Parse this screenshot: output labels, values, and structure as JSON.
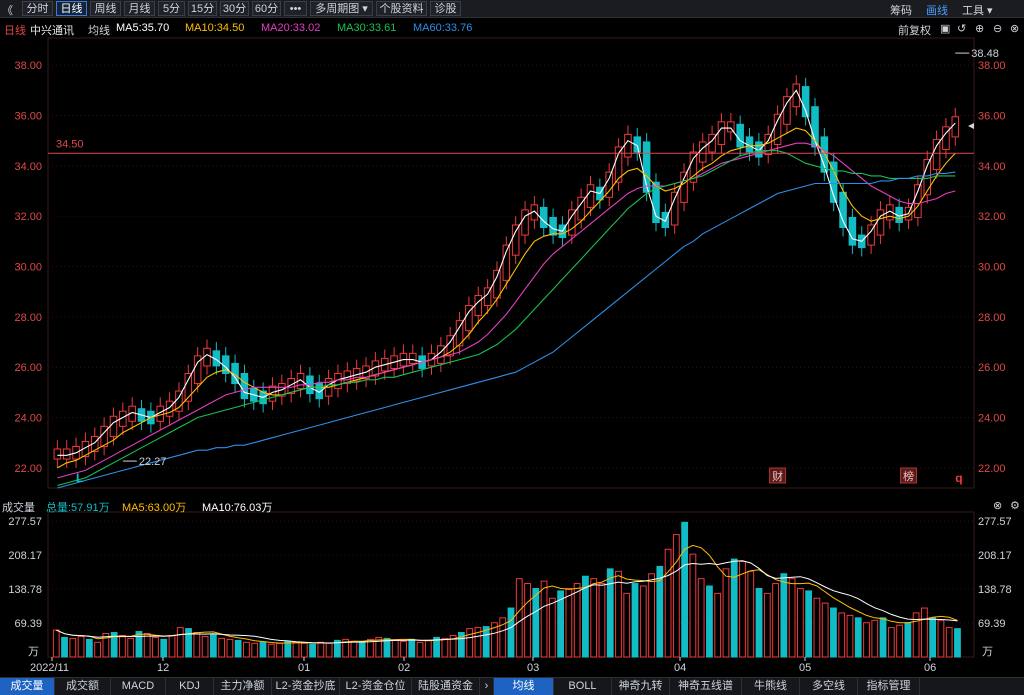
{
  "toolbar": {
    "back": "《",
    "tabs": [
      {
        "label": "分时",
        "active": false
      },
      {
        "label": "日线",
        "active": true
      },
      {
        "label": "周线",
        "active": false
      },
      {
        "label": "月线",
        "active": false
      },
      {
        "label": "5分",
        "active": false
      },
      {
        "label": "15分",
        "active": false
      },
      {
        "label": "30分",
        "active": false
      },
      {
        "label": "60分",
        "active": false
      },
      {
        "label": "•••",
        "active": false
      },
      {
        "label": "多周期图 ▾",
        "active": false
      },
      {
        "label": "个股资料",
        "active": false
      },
      {
        "label": "诊股",
        "active": false
      }
    ],
    "right": [
      {
        "label": "筹码",
        "active": false
      },
      {
        "label": "画线",
        "active": true
      },
      {
        "label": "工具 ▾",
        "active": false
      }
    ]
  },
  "infobar": {
    "period": "日线",
    "stock": "中兴通讯",
    "ma_label": "均线",
    "ma5": "MA5:35.70",
    "ma10": "MA10:34.50",
    "ma20": "MA20:33.02",
    "ma30": "MA30:33.61",
    "ma60": "MA60:33.76",
    "fq": "前复权"
  },
  "colors": {
    "up": "#f0393c",
    "down": "#11bcc5",
    "ma5": "#ffffff",
    "ma10": "#ffbf00",
    "ma20": "#e53fbf",
    "ma30": "#17c153",
    "ma60": "#2e8fe8",
    "axis": "#e04848"
  },
  "chart_data": [
    {
      "type": "line",
      "title": "中兴通讯 日线",
      "ylim": [
        21.2,
        39.0
      ],
      "yticks": [
        38.0,
        36.0,
        34.0,
        32.0,
        30.0,
        28.0,
        26.0,
        24.0,
        22.0
      ],
      "ytick_labels": [
        "38.00",
        "36.00",
        "34.00",
        "32.00",
        "30.00",
        "28.00",
        "26.00",
        "24.00",
        "22.00"
      ],
      "hline": {
        "value": 34.5,
        "label": "34.50"
      },
      "annotations": [
        {
          "label": "38.48",
          "value": 38.48,
          "index": 106
        },
        {
          "label": "22.27",
          "value": 22.27,
          "index": 7
        }
      ],
      "markers": [
        {
          "label": "L",
          "index": 2
        },
        {
          "label": "财",
          "index": 77
        },
        {
          "label": "榜",
          "index": 91
        },
        {
          "label": "q",
          "index": 118
        }
      ],
      "x_ticks": [
        "2022/11",
        "12",
        "01",
        "02",
        "03",
        "04",
        "05",
        "06"
      ],
      "series": [
        {
          "name": "MA5",
          "values": [
            22.5,
            22.5,
            22.6,
            22.8,
            23.0,
            23.4,
            23.8,
            24.0,
            24.2,
            24.1,
            24.0,
            24.2,
            24.4,
            24.8,
            25.5,
            26.2,
            26.5,
            26.3,
            26.0,
            25.6,
            25.0,
            24.9,
            24.8,
            25.0,
            25.1,
            25.3,
            25.5,
            25.2,
            25.0,
            25.3,
            25.5,
            25.6,
            25.7,
            25.8,
            26.0,
            26.1,
            26.2,
            26.3,
            26.3,
            26.2,
            26.3,
            26.6,
            27.0,
            27.6,
            28.2,
            28.6,
            28.9,
            29.6,
            30.6,
            31.4,
            32.0,
            32.2,
            31.8,
            31.5,
            31.4,
            32.0,
            32.5,
            33.0,
            32.9,
            33.5,
            34.5,
            35.0,
            34.8,
            33.2,
            32.0,
            31.8,
            32.7,
            33.5,
            34.3,
            34.7,
            35.0,
            35.5,
            35.5,
            35.0,
            34.8,
            34.6,
            35.0,
            35.8,
            36.5,
            37.0,
            36.2,
            35.0,
            34.0,
            32.8,
            31.8,
            31.1,
            31.0,
            31.4,
            32.0,
            32.2,
            32.0,
            32.1,
            33.0,
            34.0,
            34.8,
            35.3,
            35.7
          ]
        },
        {
          "name": "MA10",
          "values": [
            22.0,
            22.2,
            22.3,
            22.5,
            22.7,
            22.9,
            23.1,
            23.4,
            23.6,
            23.8,
            24.0,
            24.1,
            24.2,
            24.4,
            24.8,
            25.2,
            25.6,
            25.8,
            25.9,
            25.7,
            25.4,
            25.2,
            25.0,
            24.9,
            24.9,
            25.0,
            25.1,
            25.2,
            25.2,
            25.2,
            25.3,
            25.4,
            25.5,
            25.6,
            25.7,
            25.8,
            25.9,
            26.0,
            26.1,
            26.2,
            26.3,
            26.4,
            26.6,
            26.9,
            27.3,
            27.8,
            28.2,
            28.7,
            29.3,
            29.9,
            30.5,
            31.0,
            31.2,
            31.3,
            31.3,
            31.5,
            31.8,
            32.2,
            32.6,
            33.0,
            33.5,
            33.8,
            33.9,
            33.6,
            33.2,
            33.0,
            33.1,
            33.3,
            33.6,
            33.9,
            34.1,
            34.4,
            34.6,
            34.7,
            34.8,
            34.8,
            34.9,
            35.1,
            35.3,
            35.5,
            35.4,
            35.0,
            34.5,
            33.8,
            33.0,
            32.4,
            32.0,
            31.8,
            31.9,
            32.0,
            31.9,
            32.0,
            32.4,
            33.0,
            33.6,
            34.1,
            34.5
          ]
        },
        {
          "name": "MA20",
          "values": [
            21.6,
            21.7,
            21.8,
            21.9,
            22.1,
            22.3,
            22.5,
            22.7,
            22.9,
            23.1,
            23.3,
            23.5,
            23.7,
            23.9,
            24.1,
            24.3,
            24.5,
            24.7,
            24.9,
            25.0,
            25.1,
            25.2,
            25.2,
            25.2,
            25.2,
            25.2,
            25.3,
            25.3,
            25.4,
            25.4,
            25.5,
            25.5,
            25.6,
            25.6,
            25.7,
            25.8,
            25.9,
            26.0,
            26.1,
            26.2,
            26.3,
            26.4,
            26.5,
            26.6,
            26.8,
            27.0,
            27.3,
            27.7,
            28.1,
            28.6,
            29.1,
            29.6,
            30.1,
            30.5,
            30.8,
            31.1,
            31.4,
            31.7,
            32.0,
            32.3,
            32.6,
            32.9,
            33.1,
            33.2,
            33.2,
            33.2,
            33.3,
            33.4,
            33.5,
            33.7,
            33.9,
            34.1,
            34.2,
            34.3,
            34.4,
            34.5,
            34.6,
            34.7,
            34.8,
            34.9,
            34.9,
            34.8,
            34.6,
            34.4,
            34.1,
            33.8,
            33.5,
            33.2,
            33.0,
            32.8,
            32.6,
            32.5,
            32.5,
            32.6,
            32.7,
            32.9,
            33.0
          ]
        },
        {
          "name": "MA30",
          "values": [
            21.3,
            21.4,
            21.5,
            21.6,
            21.8,
            22.0,
            22.2,
            22.4,
            22.6,
            22.8,
            23.0,
            23.2,
            23.4,
            23.6,
            23.8,
            24.0,
            24.1,
            24.2,
            24.3,
            24.4,
            24.5,
            24.6,
            24.7,
            24.8,
            24.9,
            25.0,
            25.1,
            25.2,
            25.2,
            25.3,
            25.3,
            25.4,
            25.4,
            25.5,
            25.5,
            25.6,
            25.6,
            25.7,
            25.8,
            25.9,
            26.0,
            26.1,
            26.2,
            26.3,
            26.4,
            26.5,
            26.7,
            26.9,
            27.2,
            27.5,
            27.9,
            28.3,
            28.7,
            29.1,
            29.5,
            29.9,
            30.3,
            30.7,
            31.1,
            31.5,
            31.9,
            32.3,
            32.6,
            32.9,
            33.1,
            33.2,
            33.3,
            33.4,
            33.5,
            33.6,
            33.8,
            34.0,
            34.2,
            34.4,
            34.5,
            34.6,
            34.6,
            34.6,
            34.5,
            34.3,
            34.1,
            34.0,
            33.9,
            33.8,
            33.8,
            33.7,
            33.7,
            33.6,
            33.6,
            33.5,
            33.5,
            33.5,
            33.5,
            33.5,
            33.6,
            33.6,
            33.6
          ]
        },
        {
          "name": "MA60",
          "values": [
            21.2,
            21.3,
            21.4,
            21.5,
            21.6,
            21.7,
            21.8,
            21.9,
            22.0,
            22.1,
            22.2,
            22.3,
            22.4,
            22.5,
            22.6,
            22.7,
            22.7,
            22.8,
            22.8,
            22.9,
            22.9,
            23.0,
            23.1,
            23.2,
            23.3,
            23.4,
            23.5,
            23.6,
            23.7,
            23.8,
            23.9,
            24.0,
            24.1,
            24.2,
            24.3,
            24.4,
            24.5,
            24.6,
            24.7,
            24.8,
            24.9,
            25.0,
            25.1,
            25.2,
            25.3,
            25.4,
            25.5,
            25.6,
            25.7,
            25.8,
            26.0,
            26.2,
            26.4,
            26.6,
            26.9,
            27.2,
            27.5,
            27.8,
            28.1,
            28.4,
            28.7,
            29.0,
            29.3,
            29.6,
            29.9,
            30.2,
            30.5,
            30.8,
            31.0,
            31.3,
            31.5,
            31.7,
            31.9,
            32.1,
            32.3,
            32.5,
            32.7,
            32.9,
            33.0,
            33.1,
            33.2,
            33.3,
            33.3,
            33.3,
            33.3,
            33.3,
            33.3,
            33.3,
            33.4,
            33.4,
            33.5,
            33.5,
            33.6,
            33.6,
            33.7,
            33.7,
            33.76
          ]
        }
      ]
    },
    {
      "type": "bar",
      "title": "成交量",
      "ylim": [
        0,
        290
      ],
      "yticks": [
        277.57,
        208.17,
        138.78,
        69.39
      ],
      "ytick_labels": [
        "277.57",
        "208.17",
        "138.78",
        "69.39"
      ],
      "unit": "万",
      "legend": [
        "总量:57.91万",
        "MA5:63.00万",
        "MA10:76.03万"
      ],
      "x_ticks": [
        "2022/11",
        "12",
        "01",
        "02",
        "03",
        "04",
        "05",
        "06"
      ],
      "values": [
        55,
        40,
        38,
        42,
        36,
        30,
        48,
        50,
        44,
        38,
        52,
        48,
        40,
        36,
        44,
        60,
        58,
        50,
        42,
        46,
        38,
        36,
        34,
        30,
        28,
        30,
        26,
        28,
        32,
        30,
        28,
        26,
        30,
        28,
        34,
        36,
        32,
        30,
        36,
        40,
        38,
        34,
        32,
        36,
        30,
        34,
        40,
        38,
        44,
        50,
        58,
        60,
        62,
        70,
        80,
        100,
        160,
        150,
        140,
        155,
        120,
        135,
        140,
        150,
        165,
        160,
        150,
        180,
        175,
        130,
        150,
        145,
        170,
        185,
        220,
        250,
        275,
        210,
        160,
        145,
        130,
        180,
        200,
        195,
        175,
        140,
        130,
        150,
        170,
        160,
        140,
        135,
        120,
        110,
        100,
        90,
        85,
        80,
        70,
        75,
        80,
        60,
        65,
        70,
        90,
        100,
        80,
        75,
        60,
        57.9
      ]
    }
  ],
  "bottom_tabs": [
    {
      "label": "成交量",
      "active": true
    },
    {
      "label": "成交额",
      "active": false
    },
    {
      "label": "MACD",
      "active": false
    },
    {
      "label": "KDJ",
      "active": false
    },
    {
      "label": "主力净额",
      "active": false
    },
    {
      "label": "L2-资金抄底",
      "active": false
    },
    {
      "label": "L2-资金仓位",
      "active": false
    },
    {
      "label": "陆股通资金",
      "active": false
    },
    {
      "label": "›",
      "active": false
    },
    {
      "label": "均线",
      "active": true
    },
    {
      "label": "BOLL",
      "active": false
    },
    {
      "label": "神奇九转",
      "active": false
    },
    {
      "label": "神奇五线谱",
      "active": false
    },
    {
      "label": "牛熊线",
      "active": false
    },
    {
      "label": "多空线",
      "active": false
    },
    {
      "label": "指标管理",
      "active": false
    }
  ]
}
